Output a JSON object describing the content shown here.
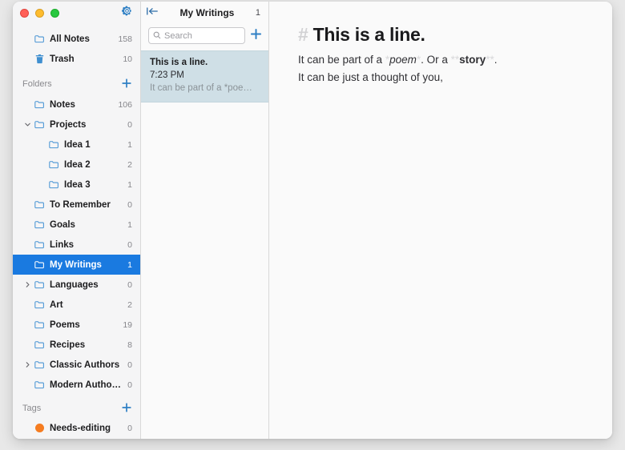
{
  "window": {
    "traffic_lights": [
      "close",
      "minimize",
      "zoom"
    ],
    "settings_icon": "gear-icon"
  },
  "sidebar": {
    "top_items": [
      {
        "label": "All Notes",
        "count": "158",
        "icon": "folder-icon"
      },
      {
        "label": "Trash",
        "count": "10",
        "icon": "trash-icon"
      }
    ],
    "folders_section": {
      "label": "Folders",
      "add_icon": "plus-icon"
    },
    "folders": [
      {
        "label": "Notes",
        "count": "106",
        "level": 0,
        "chevron": "none",
        "selected": false
      },
      {
        "label": "Projects",
        "count": "0",
        "level": 0,
        "chevron": "down",
        "selected": false
      },
      {
        "label": "Idea 1",
        "count": "1",
        "level": 1,
        "chevron": "none",
        "selected": false
      },
      {
        "label": "Idea 2",
        "count": "2",
        "level": 1,
        "chevron": "none",
        "selected": false
      },
      {
        "label": "Idea 3",
        "count": "1",
        "level": 1,
        "chevron": "none",
        "selected": false
      },
      {
        "label": "To Remember",
        "count": "0",
        "level": 0,
        "chevron": "none",
        "selected": false
      },
      {
        "label": "Goals",
        "count": "1",
        "level": 0,
        "chevron": "none",
        "selected": false
      },
      {
        "label": "Links",
        "count": "0",
        "level": 0,
        "chevron": "none",
        "selected": false
      },
      {
        "label": "My Writings",
        "count": "1",
        "level": 0,
        "chevron": "none",
        "selected": true
      },
      {
        "label": "Languages",
        "count": "0",
        "level": 0,
        "chevron": "right",
        "selected": false
      },
      {
        "label": "Art",
        "count": "2",
        "level": 0,
        "chevron": "none",
        "selected": false
      },
      {
        "label": "Poems",
        "count": "19",
        "level": 0,
        "chevron": "none",
        "selected": false
      },
      {
        "label": "Recipes",
        "count": "8",
        "level": 0,
        "chevron": "none",
        "selected": false
      },
      {
        "label": "Classic Authors",
        "count": "0",
        "level": 0,
        "chevron": "right",
        "selected": false
      },
      {
        "label": "Modern Autho…",
        "count": "0",
        "level": 0,
        "chevron": "none",
        "selected": false
      }
    ],
    "tags_section": {
      "label": "Tags",
      "add_icon": "plus-icon"
    },
    "tags": [
      {
        "label": "Needs-editing",
        "count": "0",
        "color": "#f57c20"
      }
    ]
  },
  "notelist": {
    "collapse_icon": "collapse-sidebar-icon",
    "title": "My Writings",
    "count": "1",
    "search": {
      "placeholder": "Search",
      "value": "",
      "icon": "search-icon"
    },
    "add_note_icon": "plus-icon",
    "notes": [
      {
        "title": "This is a line.",
        "time": "7:23 PM",
        "preview": "It can be part of a *poe…",
        "selected": true
      }
    ]
  },
  "editor": {
    "heading": {
      "marker": "#",
      "text": "This is a line."
    },
    "paragraph_1": {
      "part_1": "It can be part of a ",
      "em_open": "*",
      "em_text": "poem",
      "em_close": "*",
      "part_2": ". Or a ",
      "strong_open": "**",
      "strong_text": "story",
      "strong_close": "**",
      "part_3": "."
    },
    "paragraph_2": "It can be just a thought of you,"
  },
  "colors": {
    "accent": "#1a7ae0",
    "icon_blue": "#3f8fd0",
    "selected_note_bg": "#cfdfe6",
    "tag_orange": "#f57c20"
  }
}
